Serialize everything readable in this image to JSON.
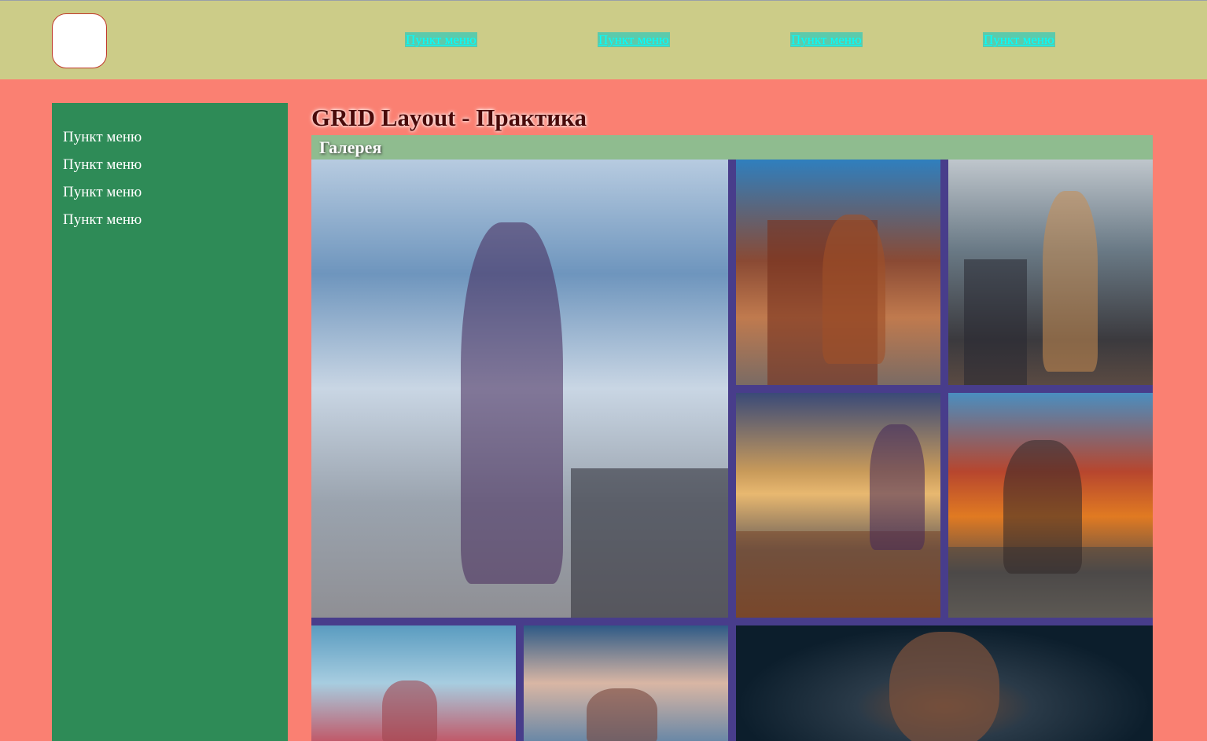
{
  "header": {
    "nav": [
      "Пункт меню",
      "Пункт меню",
      "Пункт меню",
      "Пункт меню"
    ]
  },
  "sidebar": {
    "items": [
      "Пункт меню",
      "Пункт меню",
      "Пункт меню",
      "Пункт меню"
    ]
  },
  "main": {
    "title": "GRID Layout - Практика",
    "gallery_heading": "Галерея"
  },
  "colors": {
    "page_bg": "#fa8072",
    "header_bg": "#cccc88",
    "sidebar_bg": "#2e8b57",
    "gallery_bar_bg": "#8fbc8f",
    "grid_gap": "#483d8b",
    "nav_link": "#00ffff"
  }
}
